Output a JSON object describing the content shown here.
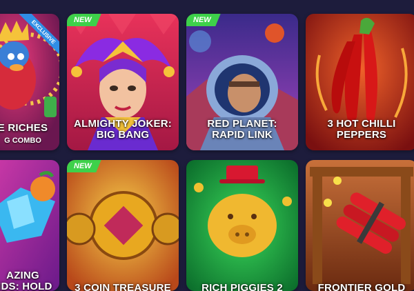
{
  "tiles": [
    {
      "id": "rich",
      "title_lines": [
        "E RICHES"
      ],
      "subtitle": "G COMBO",
      "badge": "EXCLUSIVE"
    },
    {
      "id": "joker",
      "title_lines": [
        "ALMIGHTY JOKER:",
        "BIG BANG"
      ],
      "badge": "NEW"
    },
    {
      "id": "planet",
      "title_lines": [
        "RED PLANET:",
        "RAPID LINK"
      ],
      "badge": "NEW"
    },
    {
      "id": "chilli",
      "title_lines": [
        "3 HOT CHILLI",
        "PEPPERS"
      ]
    },
    {
      "id": "diamond",
      "title_lines": [
        "AZING",
        "NDS: HOLD"
      ]
    },
    {
      "id": "coin",
      "title_lines": [
        "3 COIN TREASURE"
      ],
      "badge": "NEW"
    },
    {
      "id": "piggies",
      "title_lines": [
        "RICH PIGGIES 2"
      ]
    },
    {
      "id": "frontier",
      "title_lines": [
        "FRONTIER GOLD"
      ]
    }
  ],
  "colors": {
    "background": "#1d1c3c",
    "new_badge": "#3ed14a",
    "exclusive_badge": "#2f8ee6"
  }
}
